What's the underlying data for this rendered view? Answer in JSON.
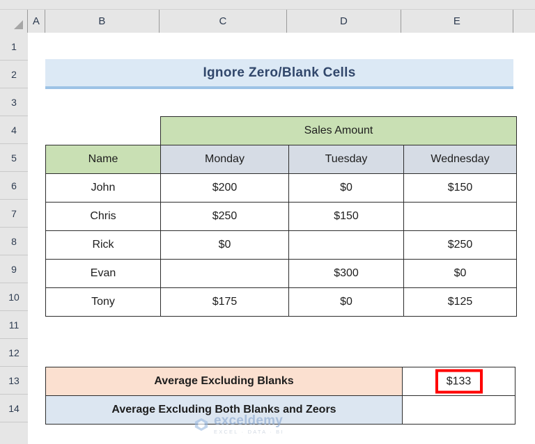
{
  "spreadsheet": {
    "column_headers": [
      "A",
      "B",
      "C",
      "D",
      "E"
    ],
    "row_headers": [
      "1",
      "2",
      "3",
      "4",
      "5",
      "6",
      "7",
      "8",
      "9",
      "10",
      "11",
      "12",
      "13",
      "14"
    ]
  },
  "title": {
    "text": "Ignore Zero/Blank Cells",
    "fill": "#DCE9F5",
    "accent": "#9DC3E6"
  },
  "table": {
    "group_header": "Sales Amount",
    "columns": [
      "Name",
      "Monday",
      "Tuesday",
      "Wednesday"
    ],
    "rows": [
      {
        "name": "John",
        "monday": "$200",
        "tuesday": "$0",
        "wednesday": "$150"
      },
      {
        "name": "Chris",
        "monday": "$250",
        "tuesday": "$150",
        "wednesday": ""
      },
      {
        "name": "Rick",
        "monday": "$0",
        "tuesday": "",
        "wednesday": "$250"
      },
      {
        "name": "Evan",
        "monday": "",
        "tuesday": "$300",
        "wednesday": "$0"
      },
      {
        "name": "Tony",
        "monday": "$175",
        "tuesday": "$0",
        "wednesday": "$125"
      }
    ],
    "header_fill_name": "#C9E0B4",
    "header_fill_days": "#D6DCE5"
  },
  "summary": {
    "rows": [
      {
        "label": "Average Excluding Blanks",
        "value": "$133",
        "fill": "#FBE0D0",
        "highlighted": true
      },
      {
        "label": "Average Excluding Both Blanks and Zeors",
        "value": "",
        "fill": "#DCE6F1",
        "highlighted": false
      }
    ],
    "highlight_color": "#FF0000"
  },
  "watermark": {
    "name": "exceldemy",
    "tagline": "EXCEL · DATA · BI"
  }
}
